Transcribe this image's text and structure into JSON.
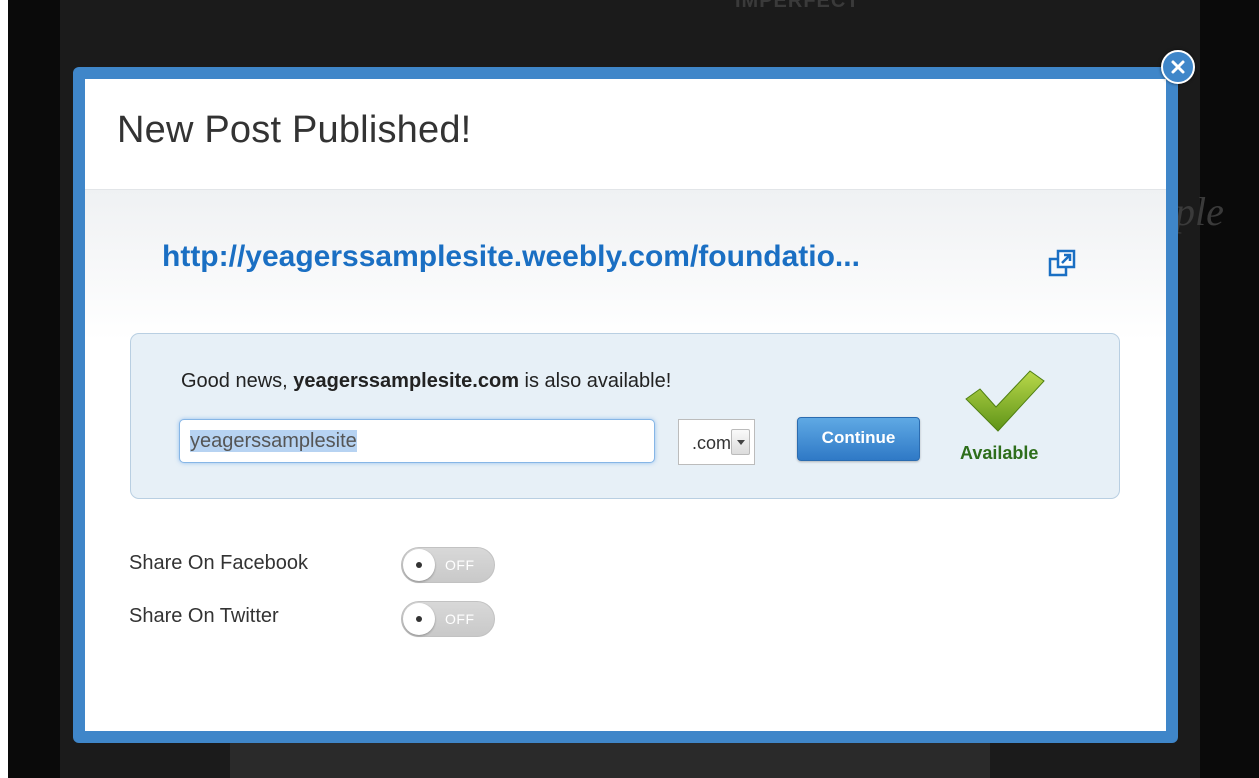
{
  "background": {
    "top_text": "IMPERFECT",
    "side_text": "ple"
  },
  "modal": {
    "title": "New Post Published!",
    "post_url": "http://yeagerssamplesite.weebly.com/foundatio...",
    "domain": {
      "message_prefix": "Good news, ",
      "message_domain": "yeagerssamplesite.com",
      "message_suffix": " is also available!",
      "input_value": "yeagerssamplesite",
      "tld_selected": ".com",
      "continue_label": "Continue",
      "status_label": "Available",
      "status_color": "#2e6e1b"
    },
    "share": [
      {
        "label": "Share On Facebook",
        "state": "OFF"
      },
      {
        "label": "Share On Twitter",
        "state": "OFF"
      }
    ]
  },
  "colors": {
    "accent": "#3f86c9",
    "link": "#1a6fc3"
  }
}
